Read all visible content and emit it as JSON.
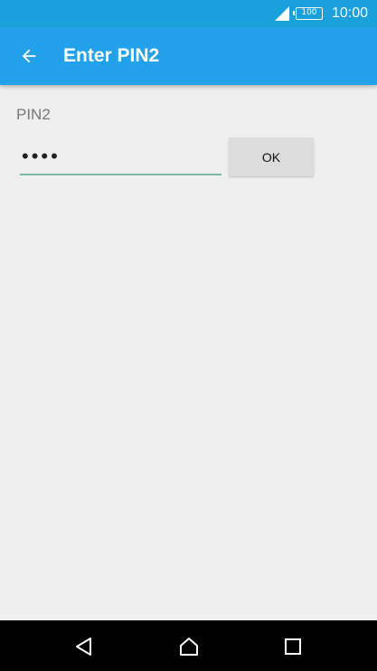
{
  "status_bar": {
    "battery_text": "100",
    "time": "10:00"
  },
  "app_bar": {
    "title": "Enter PIN2",
    "back_icon": "arrow-left-icon"
  },
  "form": {
    "label": "PIN2",
    "pin_value": "••••",
    "ok_label": "OK"
  },
  "nav_bar": {
    "icons": [
      "back-triangle-icon",
      "home-icon",
      "recents-square-icon"
    ]
  },
  "colors": {
    "status_bar": "#1aa0db",
    "app_bar": "#23a2eb",
    "background": "#efefef",
    "field_underline": "#7ab7a6",
    "button": "#dcdcdc"
  }
}
